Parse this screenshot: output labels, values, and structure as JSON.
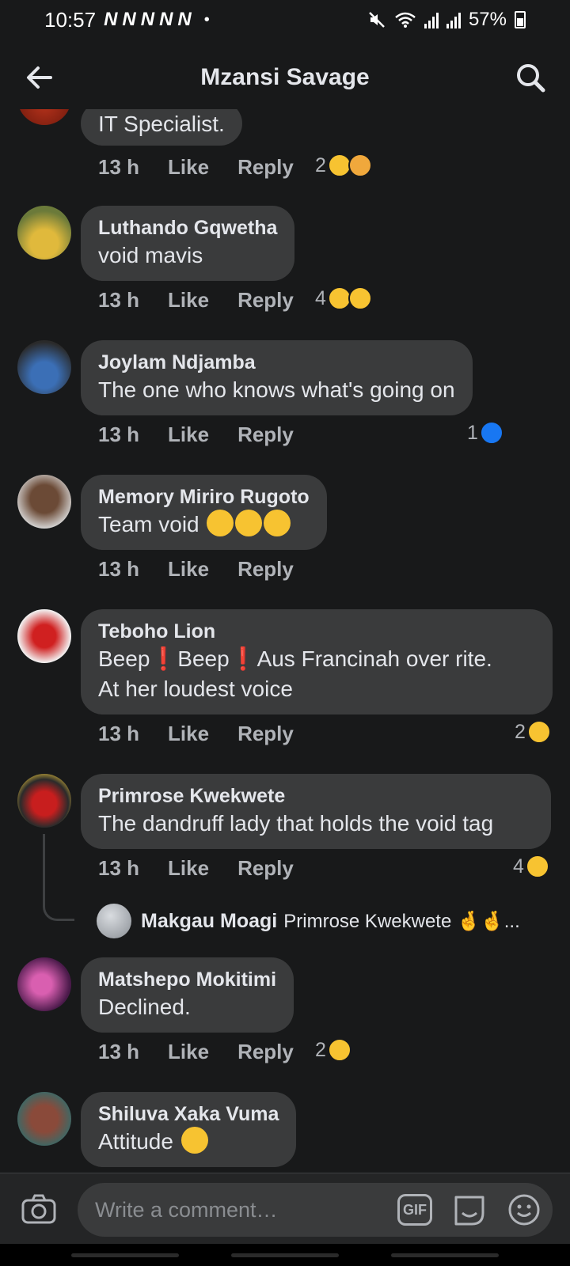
{
  "status_bar": {
    "time": "10:57",
    "notifications": "NNNNN",
    "dot": "•",
    "battery": "57%"
  },
  "header": {
    "title": "Mzansi Savage",
    "back_icon": "arrow-left-icon",
    "search_icon": "search-icon"
  },
  "actions": {
    "like": "Like",
    "reply": "Reply"
  },
  "comments": [
    {
      "name": "",
      "text": "IT Specialist.",
      "time": "13 h",
      "react_count": "2",
      "reactions": [
        "laugh",
        "care"
      ]
    },
    {
      "name": "Luthando Gqwetha",
      "text": "void mavis",
      "time": "13 h",
      "react_count": "4",
      "reactions": [
        "laugh",
        "wow"
      ]
    },
    {
      "name": "Joylam Ndjamba",
      "text": "The one who knows what's going on",
      "time": "13 h",
      "react_count": "1",
      "reactions": [
        "like"
      ]
    },
    {
      "name": "Memory Miriro Rugoto",
      "text": "Team void",
      "time": "13 h",
      "react_count": "",
      "reactions": []
    },
    {
      "name": "Teboho Lion",
      "text_line1_a": "Beep",
      "text_line1_b": "Beep",
      "text_line1_c": "Aus Francinah over rite.",
      "bang": "❗",
      "text_line2": "At her loudest voice",
      "time": "13 h",
      "react_count": "2",
      "reactions": [
        "laugh"
      ]
    },
    {
      "name": "Primrose Kwekwete",
      "text": "The dandruff lady that holds the void tag",
      "time": "13 h",
      "react_count": "4",
      "reactions": [
        "laugh"
      ]
    },
    {
      "name": "Matshepo Mokitimi",
      "text": "Declined.",
      "time": "13 h",
      "react_count": "2",
      "reactions": [
        "laugh"
      ]
    },
    {
      "name": "Shiluva Xaka Vuma",
      "text": "Attitude",
      "time": "",
      "react_count": "",
      "reactions": []
    }
  ],
  "reply_preview": {
    "name": "Makgau Moagi",
    "text": "Primrose Kwekwete 🤞🤞..."
  },
  "composer": {
    "placeholder": "Write a comment…",
    "gif_label": "GIF"
  },
  "colors": {
    "background": "#18191a",
    "bubble": "#3a3b3c",
    "secondary_text": "#b0b3b8",
    "like_blue": "#1877f2",
    "emoji_yellow": "#f7c331"
  }
}
